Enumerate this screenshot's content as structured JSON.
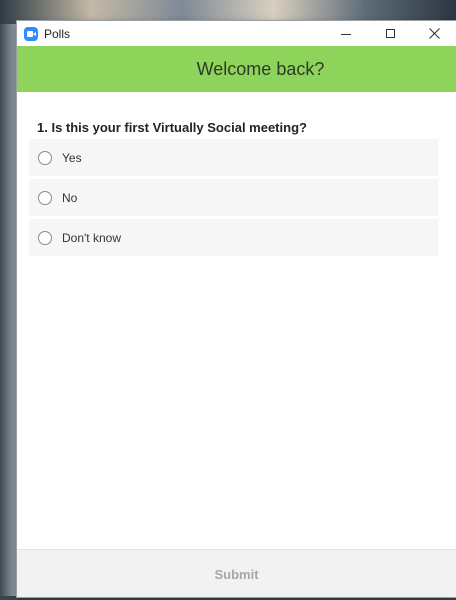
{
  "window": {
    "title": "Polls",
    "icon": "zoom-app-icon",
    "controls": {
      "minimize": "minimize-icon",
      "maximize": "maximize-icon",
      "close": "close-icon"
    }
  },
  "poll": {
    "title": "Welcome back?",
    "accent_color": "#8fd45a",
    "question": "1. Is this your first Virtually Social meeting?",
    "options": [
      {
        "label": "Yes",
        "selected": false
      },
      {
        "label": "No",
        "selected": false
      },
      {
        "label": "Don't know",
        "selected": false
      }
    ]
  },
  "footer": {
    "submit_label": "Submit",
    "submit_enabled": false
  }
}
